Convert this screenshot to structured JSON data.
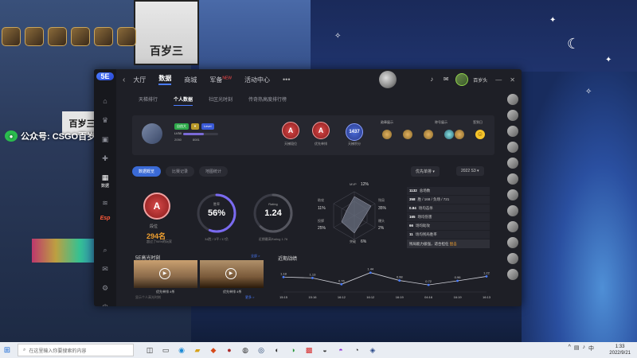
{
  "desktop": {
    "poster_text": "百岁三",
    "poster2_text": "百岁三",
    "wechat_text": "公众号: CSGO百岁三"
  },
  "app": {
    "logo": "5E",
    "nav": [
      {
        "label": "大厅"
      },
      {
        "label": "数据"
      },
      {
        "label": "商城"
      },
      {
        "label": "军备",
        "badge": "NEW"
      },
      {
        "label": "活动中心"
      }
    ],
    "nav_more": "•••",
    "user_name": "百岁头",
    "side_label": "数据",
    "side_logo2": "Esp",
    "subtabs": [
      "天梯排行",
      "个人数据",
      "社区光时刻",
      "传奇热高度排行榜"
    ],
    "profile": {
      "badges": [
        "自由大",
        "▼",
        "Level"
      ],
      "lv_text": "LV50",
      "lv_progress": 0.6,
      "mini": [
        "2050",
        "8081"
      ],
      "rank1": {
        "letter": "A",
        "label": "天梯段位"
      },
      "rank2": {
        "letter": "A",
        "label": "优先单排"
      },
      "score": {
        "value": "1437",
        "label": "天梯积分"
      },
      "medals_label": "勋章展示",
      "rank_label": "称号展示",
      "sign_label": "签到日"
    },
    "filters": [
      "数据概览",
      "比赛记录",
      "地图统计"
    ],
    "select1": "优先单排 ▾",
    "select2": "2022 S3 ▾",
    "stats": {
      "rank_letter": "A",
      "rank_label": "段位",
      "rank_value": "294名",
      "rank_sub": "超过了94%的玩家",
      "winrate": {
        "caption": "胜率",
        "value": "56%",
        "sub": "34胜 / 3平 / 17负",
        "progress": 0.56
      },
      "rating": {
        "caption": "Rating",
        "value": "1.24",
        "sub": "近期最高Rating 1.76",
        "progress": 0.62
      }
    },
    "radar": {
      "labels": [
        "MVP",
        "残局",
        "爆头",
        "突破",
        "助攻",
        "投掷"
      ],
      "values": [
        "12%",
        "35%",
        "2%",
        "6%",
        "25%",
        "11%"
      ]
    },
    "stat_list": [
      {
        "value": "1132",
        "label": "总场数"
      },
      {
        "value": "358",
        "label": "胜 / 168 / 负场 / 721"
      },
      {
        "value": "0.84",
        "label": "场均击杀"
      },
      {
        "value": "165",
        "label": "场均伤害"
      },
      {
        "value": "66",
        "label": "场均助攻"
      },
      {
        "value": "11",
        "label": "场均残局胜率"
      }
    ],
    "stat_tip": {
      "text": "残局能力极强，适合担任",
      "highlight": "狙击"
    },
    "highlights": {
      "title": "5E高光时刻",
      "more": "全部 >",
      "clips": [
        {
          "caption": "优先单排 4杀"
        },
        {
          "caption": "优先单排 4杀"
        }
      ],
      "foot_left": "显示个人高光时刻",
      "foot_right": "更多 >"
    },
    "trend": {
      "title": "近期战绩",
      "more": "查看更多"
    }
  },
  "chart_data": {
    "type": "line",
    "title": "近期战绩",
    "categories": [
      "15:15",
      "15:16",
      "16:12",
      "16:12",
      "16:19",
      "04:16",
      "16:19",
      "16:13"
    ],
    "series": [
      {
        "values": [
          1.18,
          1.13,
          0.76,
          1.44,
          0.98,
          0.72,
          0.96,
          1.22
        ]
      }
    ],
    "ylim": [
      0.4,
      1.8
    ]
  },
  "taskbar": {
    "search_placeholder": "在这里输入你要搜索的内容",
    "time": "1:33",
    "date": "2022/9/21"
  }
}
